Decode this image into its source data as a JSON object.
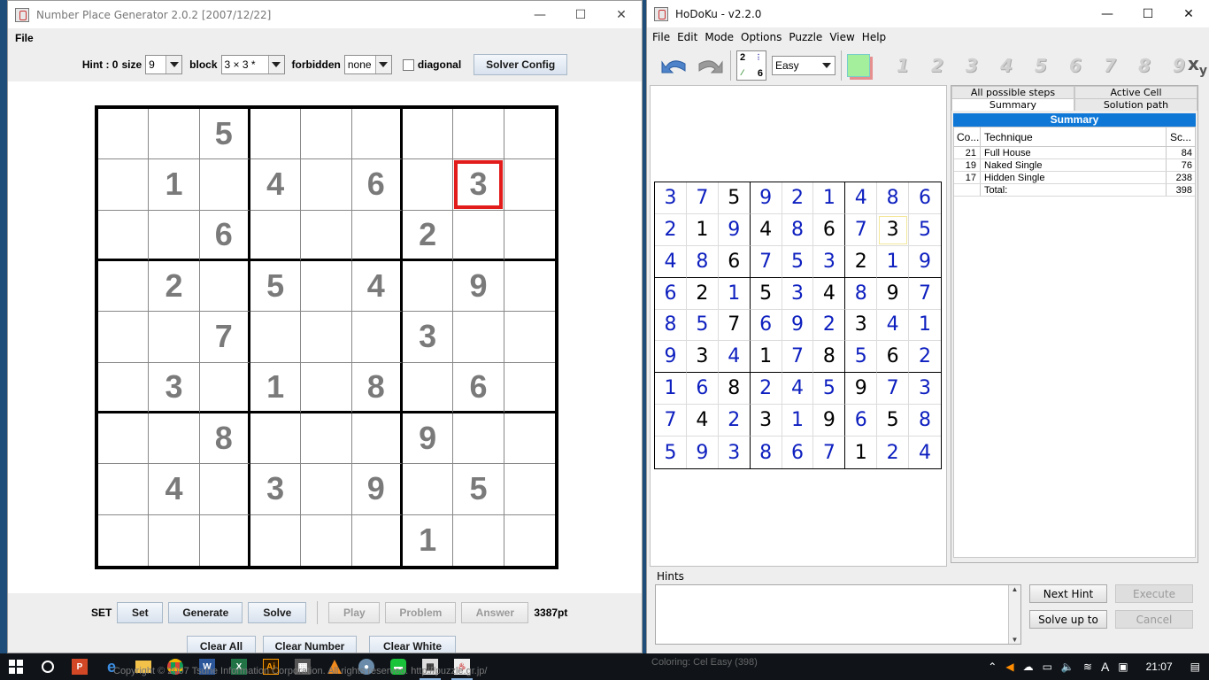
{
  "npg": {
    "title": "Number Place Generator 2.0.2 [2007/12/22]",
    "menu": [
      "File"
    ],
    "toolbar": {
      "hint_label": "Hint : 0",
      "size_label": "size",
      "size_value": "9",
      "block_label": "block",
      "block_value": "3 × 3 *",
      "forbidden_label": "forbidden",
      "forbidden_value": "none",
      "diagonal_label": "diagonal",
      "solver_config": "Solver Config"
    },
    "grid": [
      [
        "",
        "",
        "5",
        "",
        "",
        "",
        "",
        "",
        ""
      ],
      [
        "",
        "1",
        "",
        "4",
        "",
        "6",
        "",
        "3",
        ""
      ],
      [
        "",
        "",
        "6",
        "",
        "",
        "",
        "2",
        "",
        ""
      ],
      [
        "",
        "2",
        "",
        "5",
        "",
        "4",
        "",
        "9",
        ""
      ],
      [
        "",
        "",
        "7",
        "",
        "",
        "",
        "3",
        "",
        ""
      ],
      [
        "",
        "3",
        "",
        "1",
        "",
        "8",
        "",
        "6",
        ""
      ],
      [
        "",
        "",
        "8",
        "",
        "",
        "",
        "9",
        "",
        ""
      ],
      [
        "",
        "4",
        "",
        "3",
        "",
        "9",
        "",
        "5",
        ""
      ],
      [
        "",
        "",
        "",
        "",
        "",
        "",
        "1",
        "",
        ""
      ]
    ],
    "selected_cell": [
      1,
      7
    ],
    "bottom": {
      "set_label": "SET",
      "set": "Set",
      "generate": "Generate",
      "solve": "Solve",
      "play": "Play",
      "problem": "Problem",
      "answer": "Answer",
      "points": "3387pt",
      "clear_all": "Clear All",
      "clear_number": "Clear Number",
      "clear_white": "Clear White"
    },
    "footer_text": "Copyright © 2007 Tsune Information Corporation. All rights reserved. http://puzzle.gr.jp/"
  },
  "hodoku": {
    "title": "HoDoKu - v2.2.0",
    "menu": [
      "File",
      "Edit",
      "Mode",
      "Options",
      "Puzzle",
      "View",
      "Help"
    ],
    "level": "Easy",
    "filter_digits": [
      "1",
      "2",
      "3",
      "4",
      "5",
      "6",
      "7",
      "8",
      "9"
    ],
    "grid": [
      [
        "3",
        "7",
        "5",
        "9",
        "2",
        "1",
        "4",
        "8",
        "6"
      ],
      [
        "2",
        "1",
        "9",
        "4",
        "8",
        "6",
        "7",
        "3",
        "5"
      ],
      [
        "4",
        "8",
        "6",
        "7",
        "5",
        "3",
        "2",
        "1",
        "9"
      ],
      [
        "6",
        "2",
        "1",
        "5",
        "3",
        "4",
        "8",
        "9",
        "7"
      ],
      [
        "8",
        "5",
        "7",
        "6",
        "9",
        "2",
        "3",
        "4",
        "1"
      ],
      [
        "9",
        "3",
        "4",
        "1",
        "7",
        "8",
        "5",
        "6",
        "2"
      ],
      [
        "1",
        "6",
        "8",
        "2",
        "4",
        "5",
        "9",
        "7",
        "3"
      ],
      [
        "7",
        "4",
        "2",
        "3",
        "1",
        "9",
        "6",
        "5",
        "8"
      ],
      [
        "5",
        "9",
        "3",
        "8",
        "6",
        "7",
        "1",
        "2",
        "4"
      ]
    ],
    "givens": [
      [
        0,
        0,
        1,
        0,
        0,
        0,
        0,
        0,
        0
      ],
      [
        0,
        1,
        0,
        1,
        0,
        1,
        0,
        1,
        0
      ],
      [
        0,
        0,
        1,
        0,
        0,
        0,
        1,
        0,
        0
      ],
      [
        0,
        1,
        0,
        1,
        0,
        1,
        0,
        1,
        0
      ],
      [
        0,
        0,
        1,
        0,
        0,
        0,
        1,
        0,
        0
      ],
      [
        0,
        1,
        0,
        1,
        0,
        1,
        0,
        1,
        0
      ],
      [
        0,
        0,
        1,
        0,
        0,
        0,
        1,
        0,
        0
      ],
      [
        0,
        1,
        0,
        1,
        0,
        1,
        0,
        1,
        0
      ],
      [
        0,
        0,
        0,
        0,
        0,
        0,
        1,
        0,
        0
      ]
    ],
    "selected_cell": [
      1,
      7
    ],
    "tabs_top": [
      "All possible steps",
      "Active Cell"
    ],
    "tabs_bottom": [
      "Summary",
      "Solution path"
    ],
    "summary": {
      "header": "Summary",
      "columns": [
        "Co...",
        "Technique",
        "Sc..."
      ],
      "rows": [
        {
          "count": "21",
          "technique": "Full House",
          "score": "84"
        },
        {
          "count": "19",
          "technique": "Naked Single",
          "score": "76"
        },
        {
          "count": "17",
          "technique": "Hidden Single",
          "score": "238"
        },
        {
          "count": "",
          "technique": "Total:",
          "score": "398"
        }
      ]
    },
    "hints": {
      "legend": "Hints",
      "next_hint": "Next Hint",
      "execute": "Execute",
      "solve_up_to": "Solve up to",
      "cancel": "Cancel"
    },
    "status_bits": "Coloring: Cel   Easy (398)"
  },
  "taskbar": {
    "clock": "21:07",
    "apps": [
      "windows-start",
      "cortana",
      "powerpoint",
      "edge",
      "explorer",
      "chrome",
      "word",
      "excel",
      "illustrator",
      "calculator",
      "vlc",
      "app-green",
      "line",
      "hodoku",
      "java"
    ],
    "ime": "A"
  },
  "colors": {
    "hodoku_given": "#000000",
    "hodoku_solved": "#0d1fbf",
    "selected_red": "#e21b1b",
    "summary_blue": "#0f78d7"
  }
}
